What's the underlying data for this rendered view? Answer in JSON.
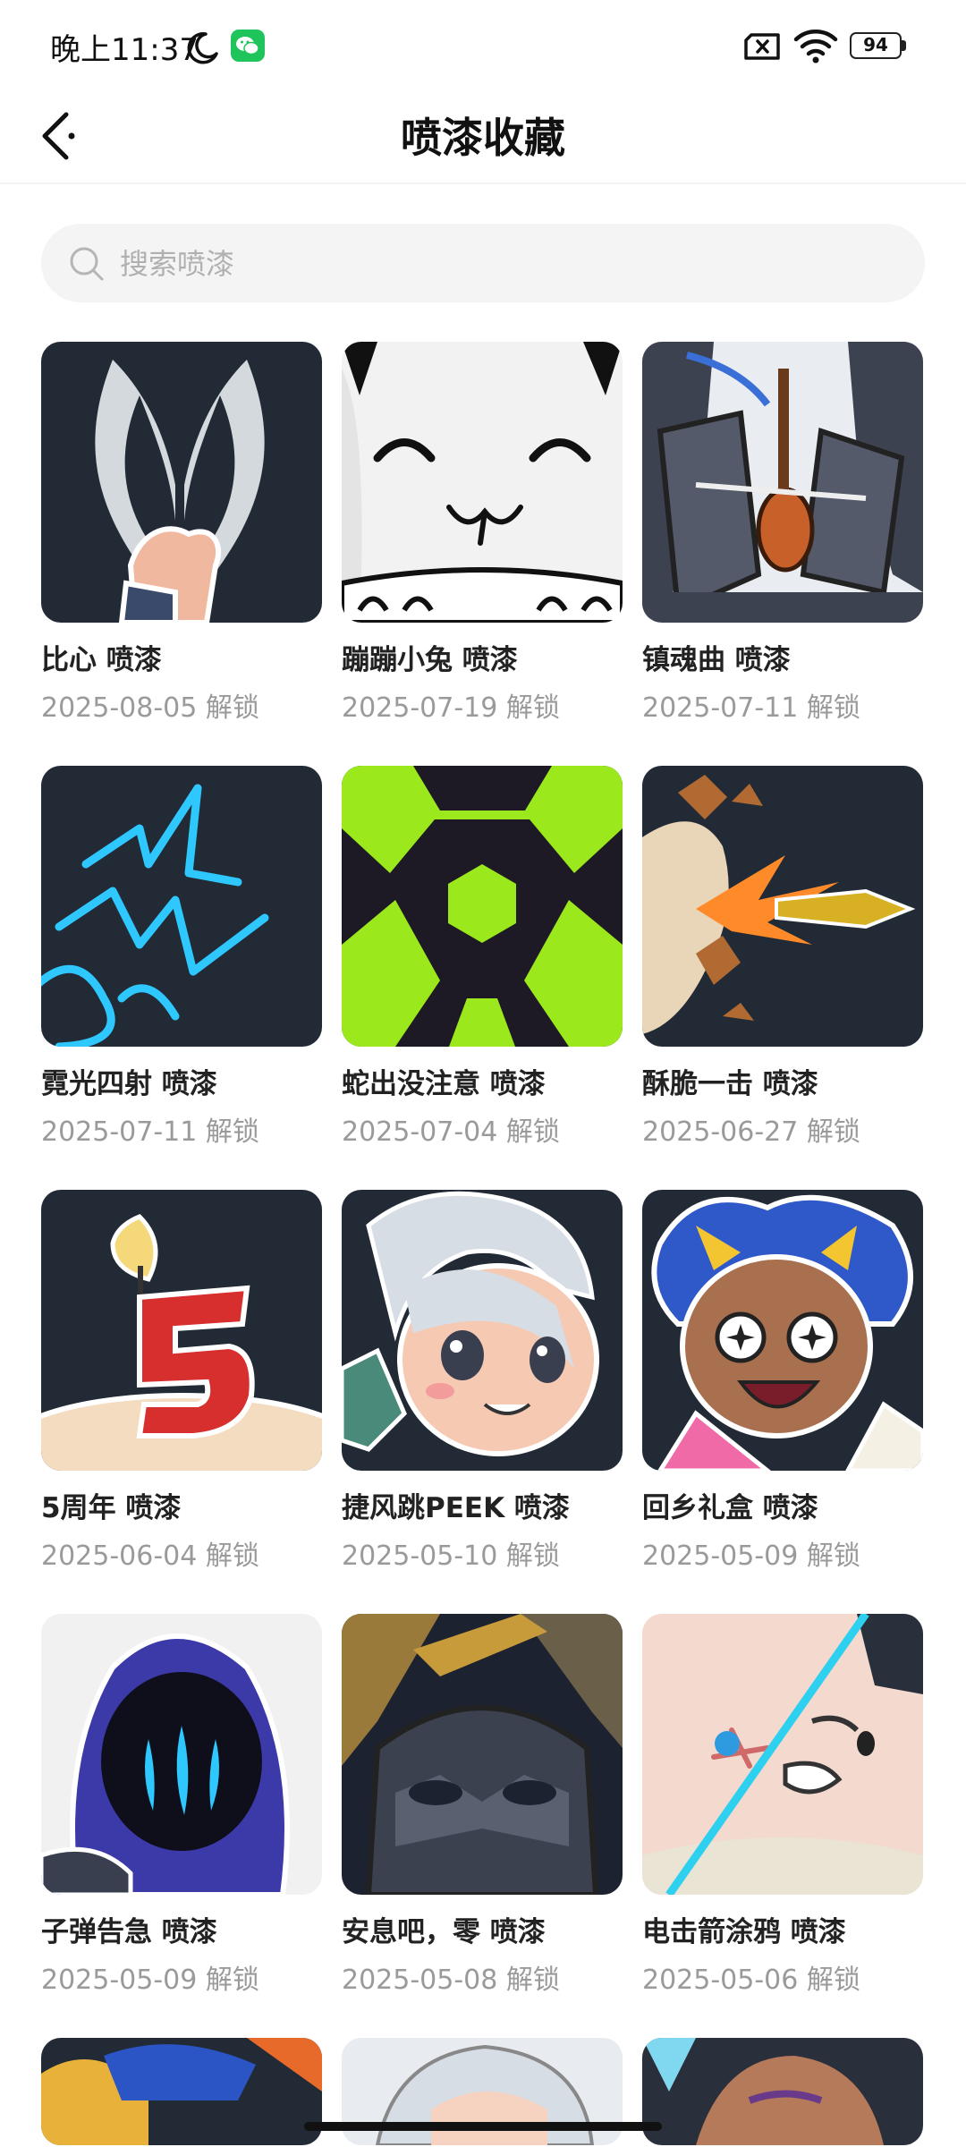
{
  "status": {
    "time": "晚上11:37",
    "battery": "94"
  },
  "header": {
    "title": "喷漆收藏"
  },
  "search": {
    "placeholder": "搜索喷漆"
  },
  "sprays": [
    {
      "name": "比心 喷漆",
      "date": "2025-08-05 解锁"
    },
    {
      "name": "蹦蹦小兔 喷漆",
      "date": "2025-07-19 解锁"
    },
    {
      "name": "镇魂曲 喷漆",
      "date": "2025-07-11 解锁"
    },
    {
      "name": "霓光四射 喷漆",
      "date": "2025-07-11 解锁"
    },
    {
      "name": "蛇出没注意 喷漆",
      "date": "2025-07-04 解锁"
    },
    {
      "name": "酥脆一击 喷漆",
      "date": "2025-06-27 解锁"
    },
    {
      "name": "5周年 喷漆",
      "date": "2025-06-04 解锁"
    },
    {
      "name": "捷风跳PEEK 喷漆",
      "date": "2025-05-10 解锁"
    },
    {
      "name": "回乡礼盒 喷漆",
      "date": "2025-05-09 解锁"
    },
    {
      "name": "子弹告急 喷漆",
      "date": "2025-05-09 解锁"
    },
    {
      "name": "安息吧，零 喷漆",
      "date": "2025-05-08 解锁"
    },
    {
      "name": "电击箭涂鸦 喷漆",
      "date": "2025-05-06 解锁"
    }
  ],
  "colors": {
    "tile_dark": "#222a36",
    "neon_green": "#9be81c",
    "neon_blue": "#2ec8ff",
    "wechat_green": "#1fc45a"
  }
}
